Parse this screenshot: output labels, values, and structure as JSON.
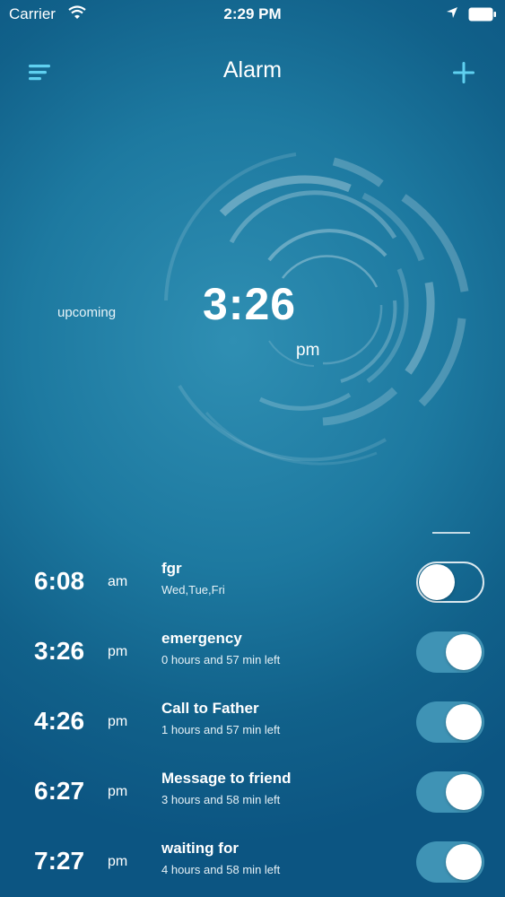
{
  "status_bar": {
    "carrier": "Carrier",
    "time": "2:29 PM"
  },
  "header": {
    "title": "Alarm"
  },
  "upcoming": {
    "label": "upcoming",
    "time": "3:26",
    "ampm": "pm"
  },
  "alarms": [
    {
      "time": "6:08",
      "ampm": "am",
      "label": "fgr",
      "subtitle": "Wed,Tue,Fri",
      "enabled": false
    },
    {
      "time": "3:26",
      "ampm": "pm",
      "label": "emergency",
      "subtitle": "0 hours and 57 min left",
      "enabled": true
    },
    {
      "time": "4:26",
      "ampm": "pm",
      "label": "Call to Father",
      "subtitle": "1 hours and 57 min left",
      "enabled": true
    },
    {
      "time": "6:27",
      "ampm": "pm",
      "label": "Message to friend",
      "subtitle": "3 hours and 58 min left",
      "enabled": true
    },
    {
      "time": "7:27",
      "ampm": "pm",
      "label": "waiting for",
      "subtitle": "4 hours and 58 min left",
      "enabled": true
    }
  ],
  "colors": {
    "accent": "#5fd0f0",
    "toggle_on": "#3f93b5",
    "background": "#1d79a0"
  }
}
